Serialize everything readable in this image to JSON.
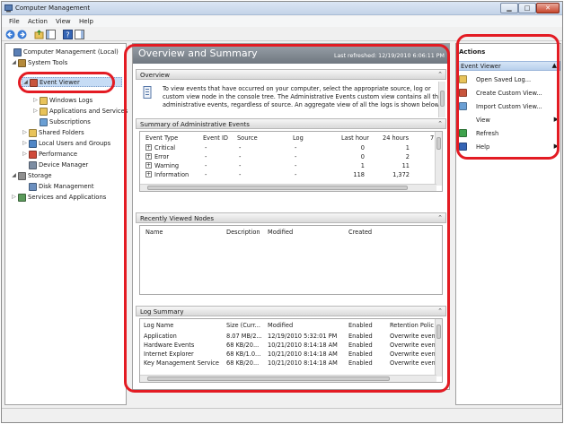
{
  "window": {
    "title": "Computer Management"
  },
  "menubar": {
    "items": [
      "File",
      "Action",
      "View",
      "Help"
    ]
  },
  "tree": {
    "items": [
      {
        "label": "Computer Management (Local)",
        "twisty": "",
        "icon": "computer-icon",
        "indent": 0
      },
      {
        "label": "System Tools",
        "twisty": "◢",
        "icon": "tools-icon",
        "indent": 1
      },
      {
        "label": "Event Viewer",
        "twisty": "◢",
        "icon": "event-viewer-icon",
        "indent": 2
      },
      {
        "label": "Windows Logs",
        "twisty": "▷",
        "icon": "folder-icon",
        "indent": 3
      },
      {
        "label": "Applications and Services",
        "twisty": "▷",
        "icon": "folder-icon",
        "indent": 3
      },
      {
        "label": "Subscriptions",
        "twisty": "",
        "icon": "subscription-icon",
        "indent": 3
      },
      {
        "label": "Shared Folders",
        "twisty": "▷",
        "icon": "shared-folder-icon",
        "indent": 2
      },
      {
        "label": "Local Users and Groups",
        "twisty": "▷",
        "icon": "users-icon",
        "indent": 2
      },
      {
        "label": "Performance",
        "twisty": "▷",
        "icon": "performance-icon",
        "indent": 2
      },
      {
        "label": "Device Manager",
        "twisty": "",
        "icon": "device-manager-icon",
        "indent": 2
      },
      {
        "label": "Storage",
        "twisty": "◢",
        "icon": "storage-icon",
        "indent": 1
      },
      {
        "label": "Disk Management",
        "twisty": "",
        "icon": "disk-icon",
        "indent": 2
      },
      {
        "label": "Services and Applications",
        "twisty": "▷",
        "icon": "services-icon",
        "indent": 1
      }
    ]
  },
  "center": {
    "title": "Overview and Summary",
    "refreshed": "Last refreshed: 12/19/2010 6:06:11 PM",
    "overview": {
      "title": "Overview",
      "text_lines": [
        "To view events that have occurred on your computer, select the appropriate source, log or",
        "custom view node in the console tree. The Administrative Events custom view contains all the",
        "administrative events, regardless of source. An aggregate view of all the logs is shown below."
      ]
    },
    "summary": {
      "title": "Summary of Administrative Events",
      "columns": [
        "Event Type",
        "Event ID",
        "Source",
        "Log",
        "Last hour",
        "24 hours",
        "7"
      ],
      "rows": [
        {
          "type": "Critical",
          "id": "-",
          "source": "-",
          "log": "-",
          "last_hour": "0",
          "day": "1"
        },
        {
          "type": "Error",
          "id": "-",
          "source": "-",
          "log": "-",
          "last_hour": "0",
          "day": "2"
        },
        {
          "type": "Warning",
          "id": "-",
          "source": "-",
          "log": "-",
          "last_hour": "1",
          "day": "11"
        },
        {
          "type": "Information",
          "id": "-",
          "source": "-",
          "log": "-",
          "last_hour": "118",
          "day": "1,372"
        }
      ]
    },
    "recent": {
      "title": "Recently Viewed Nodes",
      "columns": [
        "Name",
        "Description",
        "Modified",
        "Created"
      ]
    },
    "log_summary": {
      "title": "Log Summary",
      "columns": [
        "Log Name",
        "Size (Curr...",
        "Modified",
        "Enabled",
        "Retention Polic"
      ],
      "rows": [
        {
          "name": "Application",
          "size": "8.07 MB/2...",
          "modified": "12/19/2010 5:32:01 PM",
          "enabled": "Enabled",
          "retention": "Overwrite even"
        },
        {
          "name": "Hardware Events",
          "size": "68 KB/20...",
          "modified": "10/21/2010 8:14:18 AM",
          "enabled": "Enabled",
          "retention": "Overwrite even"
        },
        {
          "name": "Internet Explorer",
          "size": "68 KB/1.0...",
          "modified": "10/21/2010 8:14:18 AM",
          "enabled": "Enabled",
          "retention": "Overwrite even"
        },
        {
          "name": "Key Management Service",
          "size": "68 KB/20...",
          "modified": "10/21/2010 8:14:18 AM",
          "enabled": "Enabled",
          "retention": "Overwrite even"
        }
      ]
    }
  },
  "actions": {
    "title": "Actions",
    "section": "Event Viewer",
    "items": [
      {
        "label": "Open Saved Log...",
        "icon": "open-log-icon",
        "submenu": false
      },
      {
        "label": "Create Custom View...",
        "icon": "create-view-icon",
        "submenu": false
      },
      {
        "label": "Import Custom View...",
        "icon": "import-view-icon",
        "submenu": false
      },
      {
        "label": "View",
        "icon": "",
        "submenu": true
      },
      {
        "label": "Refresh",
        "icon": "refresh-icon",
        "submenu": false
      },
      {
        "label": "Help",
        "icon": "help-icon",
        "submenu": true
      }
    ]
  },
  "colors": {
    "annotation": "#e31b23",
    "header_gray": "#7d858d",
    "selection": "#c6dcf5"
  }
}
